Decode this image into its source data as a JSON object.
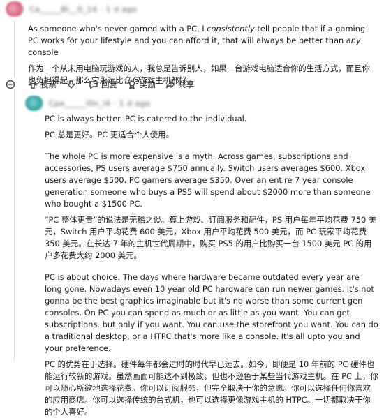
{
  "comment1": {
    "en": "As someone who's never gamed with a PC, I consistently tell people that if a gaming PC works for your lifestyle and you can afford it, that will always be better than any console",
    "en_parts": [
      "As someone who's never gamed with a PC, I ",
      "consistently",
      " tell people that if a gaming PC works for your lifestyle and you can afford it, that will always be better than ",
      "any",
      " console"
    ],
    "zh_parts": [
      "作为一个从未用电脑玩游戏的人，我总是告诉别人，如果一台游戏电脑适合你的生活方式，而且你也负担得起，那么它永远比",
      "任何",
      "游戏主机都好。"
    ]
  },
  "actions": {
    "upvote_label": "投票",
    "reply_label": "回复",
    "award_label": "奖励",
    "share_label": "共享"
  },
  "comment2": {
    "p1_en": "PC is always better. PC is catered to the individual.",
    "p1_zh": "PC 总是更好。PC 更适合个人使用。",
    "p2_en": "The whole PC is more expensive is a myth. Across games, subscriptions and accessories, PS users average $750 annually. Switch users averages $600. Xbox users average $500. PC gamers average $350. Over an entire 7 year console generation someone who buys a PS5 will spend about $2000 more than someone who bought a $1500 PC.",
    "p2_zh": "“PC 整体更贵”的说法是无稽之谈。算上游戏、订阅服务和配件，PS 用户每年平均花费 750 美元，Switch 用户平均花费 600 美元，Xbox 用户平均花费 500 美元，而 PC 玩家平均花费 350 美元。在长达 7 年的主机世代周期中，购买 PS5 的用户比购买一台 1500 美元 PC 的用户多花费大约 2000 美元。",
    "p3_en": "PC is about choice. The days where hardware became outdated every year are long gone. Nowadays even 10 year old PC hardware can run newer games. It's not gonna be the best graphics imaginable but it's no worse than some current gen consoles. On PC you can spend as much or as little as you want. You can get subscriptions. but only if you want. You can use the storefront you want. You can do a traditional desktop, or a HTPC that's more like a console. It's all upto you and your preference.",
    "p3_zh": "PC 的优势在于选择。硬件每年都会过时的时代早已远去。如今，即便是 10 年前的 PC 硬件也能运行较新的游戏。虽然画面可能达不到极致，但也不逊色于某些当代游戏主机。在 PC 上，你可以随心所欲地选择花费。你可以订阅服务，但完全取决于你的意愿。你可以选择任何你喜欢的应用商店。你可以选择传统的台式机，也可以选择更像游戏主机的 HTPC。一切都取决于你的个人喜好。"
  }
}
